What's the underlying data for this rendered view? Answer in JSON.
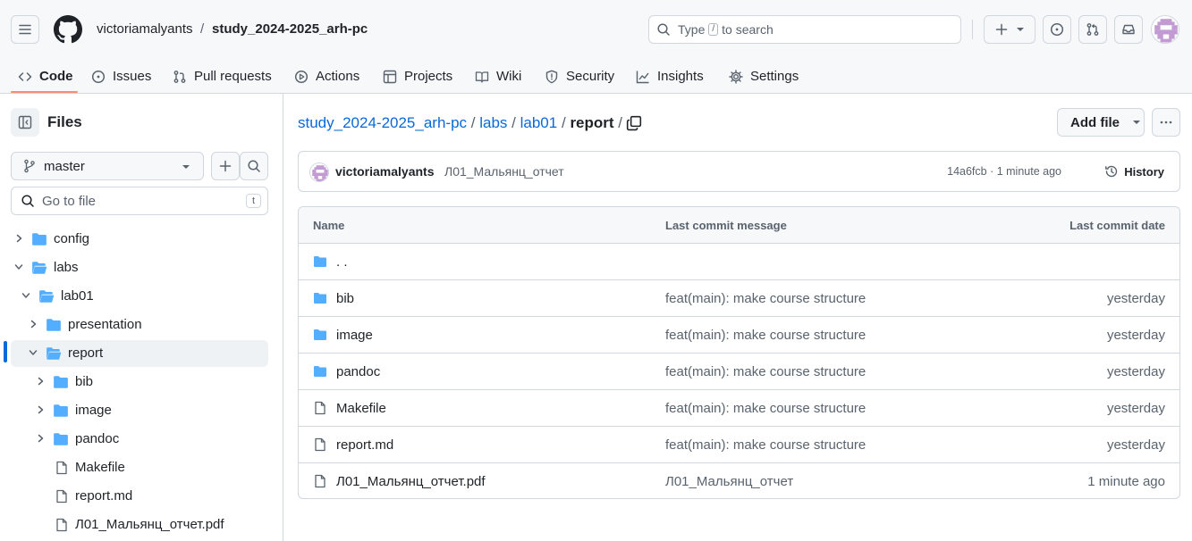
{
  "header": {
    "owner": "victoriamalyants",
    "separator": "/",
    "repo": "study_2024-2025_arh-pc",
    "search": {
      "prefix": "Type",
      "key": "/",
      "suffix": "to search"
    }
  },
  "tabs": [
    {
      "label": "Code",
      "icon": "code-icon",
      "selected": true
    },
    {
      "label": "Issues",
      "icon": "issue-icon"
    },
    {
      "label": "Pull requests",
      "icon": "pull-request-icon"
    },
    {
      "label": "Actions",
      "icon": "play-icon"
    },
    {
      "label": "Projects",
      "icon": "table-icon"
    },
    {
      "label": "Wiki",
      "icon": "book-icon"
    },
    {
      "label": "Security",
      "icon": "shield-icon"
    },
    {
      "label": "Insights",
      "icon": "graph-icon"
    },
    {
      "label": "Settings",
      "icon": "gear-icon"
    }
  ],
  "sidebar": {
    "title": "Files",
    "branch": "master",
    "goto_placeholder": "Go to file",
    "goto_shortcut": "t",
    "tree": [
      {
        "label": "config",
        "type": "folder",
        "expanded": false
      },
      {
        "label": "labs",
        "type": "folder",
        "expanded": true
      },
      {
        "label": "lab01",
        "type": "folder",
        "expanded": true
      },
      {
        "label": "presentation",
        "type": "folder",
        "expanded": false
      },
      {
        "label": "report",
        "type": "folder",
        "expanded": true,
        "active": true
      },
      {
        "label": "bib",
        "type": "folder",
        "expanded": false
      },
      {
        "label": "image",
        "type": "folder",
        "expanded": false
      },
      {
        "label": "pandoc",
        "type": "folder",
        "expanded": false
      },
      {
        "label": "Makefile",
        "type": "file"
      },
      {
        "label": "report.md",
        "type": "file"
      },
      {
        "label": "Л01_Мальянц_отчет.pdf",
        "type": "file"
      }
    ]
  },
  "path": {
    "repo": "study_2024-2025_arh-pc",
    "parts": [
      "labs",
      "lab01"
    ],
    "current": "report",
    "sep": "/"
  },
  "actions": {
    "add_file": "Add file"
  },
  "commit": {
    "author": "victoriamalyants",
    "message": "Л01_Мальянц_отчет",
    "meta": "14a6fcb · 1 minute ago",
    "history": "History"
  },
  "table": {
    "headers": {
      "name": "Name",
      "message": "Last commit message",
      "date": "Last commit date"
    },
    "parent": ". .",
    "rows": [
      {
        "name": "bib",
        "type": "folder",
        "message": "feat(main): make course structure",
        "date": "yesterday"
      },
      {
        "name": "image",
        "type": "folder",
        "message": "feat(main): make course structure",
        "date": "yesterday"
      },
      {
        "name": "pandoc",
        "type": "folder",
        "message": "feat(main): make course structure",
        "date": "yesterday"
      },
      {
        "name": "Makefile",
        "type": "file",
        "message": "feat(main): make course structure",
        "date": "yesterday"
      },
      {
        "name": "report.md",
        "type": "file",
        "message": "feat(main): make course structure",
        "date": "yesterday"
      },
      {
        "name": "Л01_Мальянц_отчет.pdf",
        "type": "file",
        "message": "Л01_Мальянц_отчет",
        "date": "1 minute ago"
      }
    ]
  },
  "colors": {
    "link": "#0969da",
    "folder": "#54aeff",
    "tab_underline": "#fd8c73",
    "muted": "#59636e"
  }
}
